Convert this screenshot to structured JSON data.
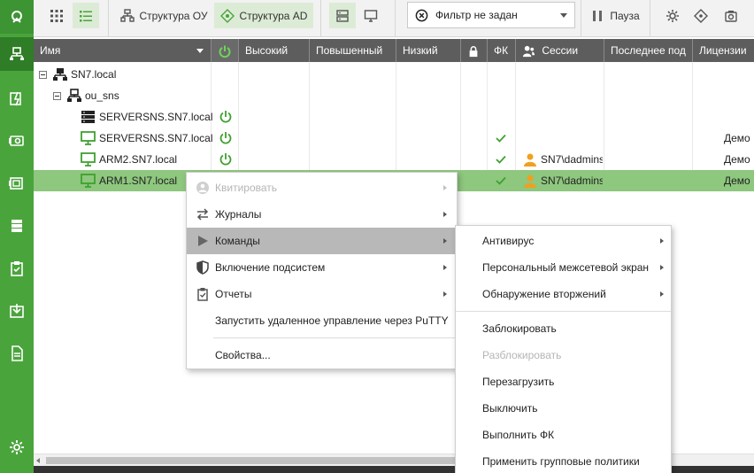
{
  "toolbar": {
    "structure_ou": "Структура ОУ",
    "structure_ad": "Структура AD",
    "filter": "Фильтр не задан",
    "pause": "Пауза"
  },
  "columns": {
    "name": "Имя",
    "high": "Высокий",
    "elevated": "Повышенный",
    "low": "Низкий",
    "fk": "ФК",
    "sessions": "Сессии",
    "last": "Последнее под",
    "licenses": "Лицензии"
  },
  "rows": [
    {
      "name": "SN7.local"
    },
    {
      "name": "ou_sns"
    },
    {
      "name": "SERVERSNS.SN7.local"
    },
    {
      "name": "SERVERSNS.SN7.local",
      "license": "Демо"
    },
    {
      "name": "ARM2.SN7.local",
      "session": "SN7\\dadmins",
      "license": "Демо"
    },
    {
      "name": "ARM1.SN7.local",
      "session": "SN7\\dadmins",
      "license": "Демо"
    }
  ],
  "context_menu": {
    "acknowledge": "Квитировать",
    "journals": "Журналы",
    "commands": "Команды",
    "subsystems": "Включение подсистем",
    "reports": "Отчеты",
    "putty": "Запустить удаленное управление через PuTTY",
    "properties": "Свойства..."
  },
  "submenu": {
    "antivirus": "Антивирус",
    "firewall": "Персональный межсетевой экран",
    "intrusion": "Обнаружение вторжений",
    "block": "Заблокировать",
    "unblock": "Разблокировать",
    "reboot": "Перезагрузить",
    "shutdown": "Выключить",
    "run_fk": "Выполнить ФК",
    "group_policies": "Применить групповые политики"
  },
  "colors": {
    "accent": "#4aa43c",
    "selection": "#8ec77e",
    "header": "#5d5d5d",
    "hover": "#b8b8b8"
  }
}
